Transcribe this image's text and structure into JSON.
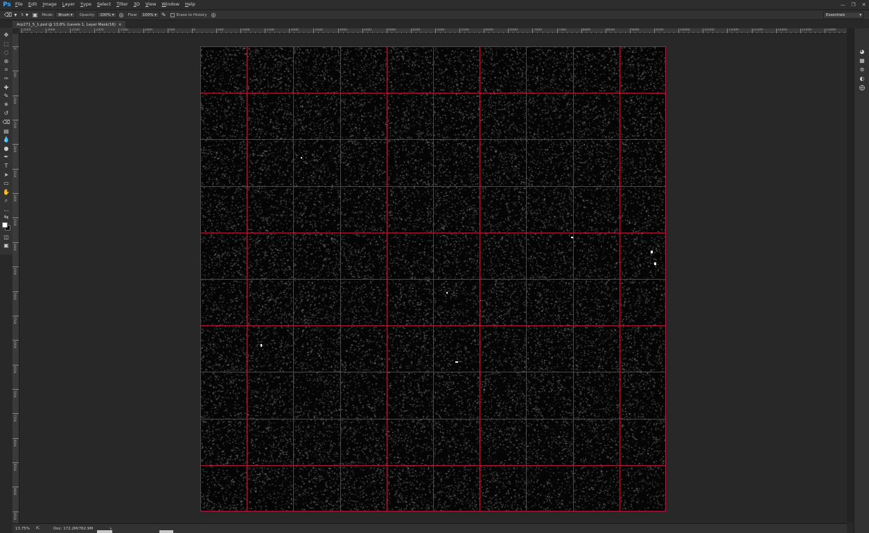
{
  "app": {
    "logo": "Ps",
    "menu": [
      {
        "label": "File",
        "underline": "F",
        "rest": "ile"
      },
      {
        "label": "Edit",
        "underline": "E",
        "rest": "dit"
      },
      {
        "label": "Image",
        "underline": "I",
        "rest": "mage"
      },
      {
        "label": "Layer",
        "underline": "L",
        "rest": "ayer"
      },
      {
        "label": "Type",
        "underline": "Y",
        "rest": "ype"
      },
      {
        "label": "Select",
        "underline": "S",
        "rest": "elect"
      },
      {
        "label": "Filter",
        "underline": "T",
        "rest": "ilter"
      },
      {
        "label": "3D",
        "underline": "3",
        "rest": "D"
      },
      {
        "label": "View",
        "underline": "V",
        "rest": "iew"
      },
      {
        "label": "Window",
        "underline": "W",
        "rest": "indow"
      },
      {
        "label": "Help",
        "underline": "H",
        "rest": "elp"
      }
    ],
    "window_controls": {
      "minimize": "—",
      "restore": "❐",
      "close": "✕"
    }
  },
  "options": {
    "brush_size": "5",
    "mode_label": "Mode:",
    "mode_value": "Brush",
    "opacity_label": "Opacity:",
    "opacity_value": "100%",
    "flow_label": "Flow:",
    "flow_value": "100%",
    "erase_to_history": "Erase to History",
    "workspace": "Essentials"
  },
  "document": {
    "tab_title": "Arp271_5_1.psd @ 13.8% (Levels 1, Layer Mask/16)",
    "tab_close": "×"
  },
  "ruler": {
    "top_labels": [
      "3500",
      "3000",
      "2500",
      "2000",
      "1500",
      "1000",
      "500",
      "0",
      "500",
      "1000",
      "1500",
      "2000",
      "2500",
      "3000",
      "3500",
      "4000",
      "4500",
      "5000",
      "5500",
      "6000",
      "6500",
      "7000",
      "7500",
      "8000",
      "8500",
      "9000",
      "9500",
      "10000",
      "10500",
      "11000",
      "11500",
      "12000",
      "12500",
      "13000"
    ],
    "left_labels": [
      "0",
      "500",
      "1000",
      "1500",
      "2000",
      "2500",
      "3000",
      "3500",
      "4000",
      "4500",
      "5000",
      "5500",
      "6000",
      "6500",
      "7000",
      "7500",
      "8000",
      "8500",
      "9000",
      "9500"
    ]
  },
  "canvas": {
    "grid_rows": 10,
    "grid_cols": 10,
    "grid_color": "#b0183e",
    "background": "#050505"
  },
  "status": {
    "zoom": "13.75%",
    "doc": "Doc: 172.2M/762.9M"
  },
  "icons": {
    "toolbar": [
      "move-icon",
      "marquee-icon",
      "lasso-icon",
      "quick-select-icon",
      "crop-icon",
      "eyedropper-icon",
      "healing-brush-icon",
      "brush-icon",
      "clone-stamp-icon",
      "history-brush-icon",
      "eraser-icon",
      "gradient-icon",
      "blur-icon",
      "dodge-icon",
      "pen-icon",
      "type-icon",
      "path-select-icon",
      "rectangle-icon",
      "hand-icon",
      "zoom-icon",
      "more-tools-icon",
      "swap-colors-icon",
      "foreground-color-icon",
      "quick-mask-icon",
      "screen-mode-icon"
    ],
    "right_panel": [
      "color-panel-icon",
      "swatches-icon",
      "libraries-icon",
      "adjustments-icon",
      "styles-icon"
    ]
  }
}
